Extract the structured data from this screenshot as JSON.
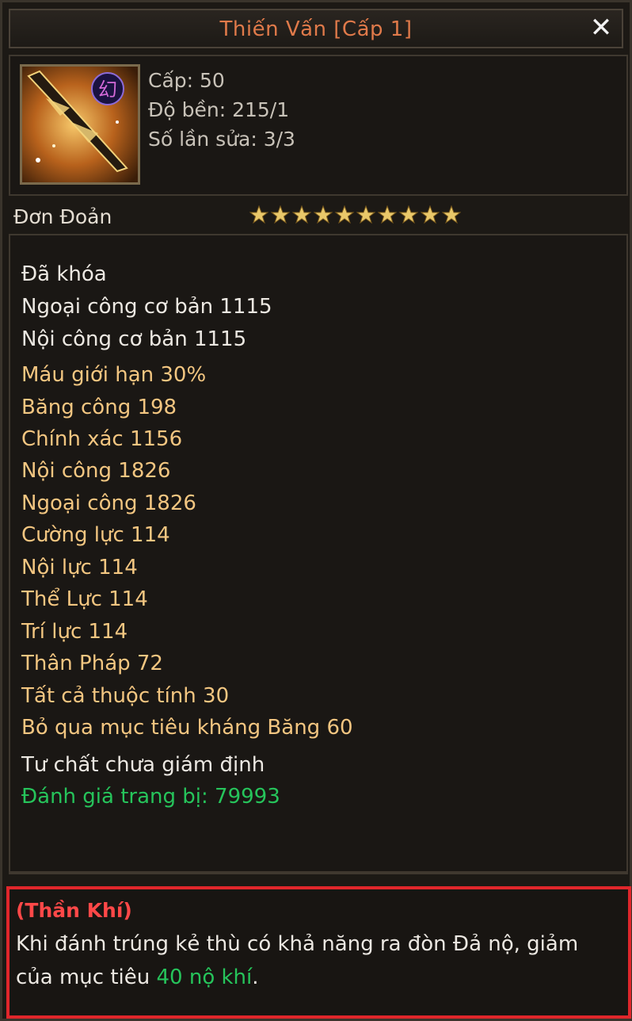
{
  "window": {
    "title": "Thiến Vấn [Cấp 1]",
    "close_label": "✕"
  },
  "item": {
    "icon": "sword-item-icon",
    "icon_glyph": "幻",
    "level": "Cấp: 50",
    "durability": "Độ bền: 215/1",
    "repairs": "Số lần sửa: 3/3"
  },
  "quality": {
    "label": "Đơn Đoản",
    "stars": 10,
    "star_color": "#e9c86a"
  },
  "status": {
    "locked": "Đã khóa",
    "base_outer": "Ngoại công cơ bản 1115",
    "base_inner": "Nội công cơ bản 1115"
  },
  "attributes": [
    "Máu giới hạn 30%",
    "Băng công 198",
    "Chính xác 1156",
    "Nội công 1826",
    "Ngoại công 1826",
    "Cường lực 114",
    "Nội lực 114",
    "Thể Lực 114",
    "Trí lực 114",
    "Thân Pháp 72",
    "Tất cả thuộc tính 30",
    "Bỏ qua mục tiêu kháng Băng 60"
  ],
  "aptitude": "Tư chất chưa giám định",
  "rating": "Đánh giá trang bị: 79993",
  "divine": {
    "title": "(Thần Khí)",
    "desc_part1": "Khi đánh trúng kẻ thù có khả năng ra đòn Đả nộ, giảm của mục tiêu ",
    "desc_highlight": "40 nộ khí",
    "desc_end": "."
  },
  "colors": {
    "title": "#e07a4a",
    "attr_gold": "#f3c681",
    "rating_green": "#26c45b",
    "highlight_red": "#e0262b"
  }
}
